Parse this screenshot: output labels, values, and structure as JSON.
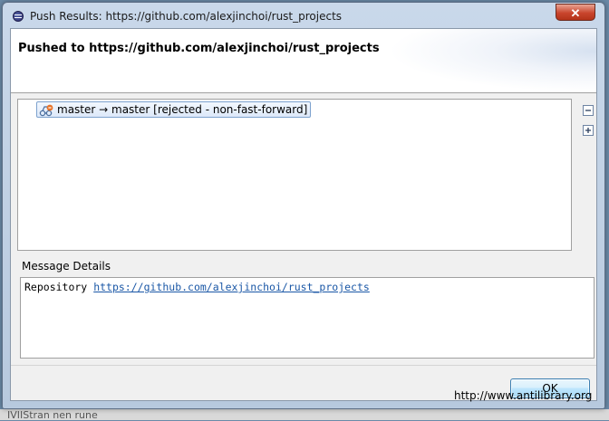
{
  "window": {
    "title": "Push Results: https://github.com/alexjinchoi/rust_projects",
    "close_glyph": "✕"
  },
  "header": {
    "text": "Pushed to https://github.com/alexjinchoi/rust_projects"
  },
  "tree": {
    "items": [
      {
        "label": "master → master [rejected - non-fast-forward]",
        "icon": "rejected-push-icon"
      }
    ]
  },
  "side_buttons": {
    "collapse": "collapse-all-icon",
    "expand": "expand-all-icon"
  },
  "message_details": {
    "label": "Message Details",
    "prefix": "Repository",
    "link": "https://github.com/alexjinchoi/rust_projects"
  },
  "buttons": {
    "ok": "OK"
  },
  "watermark": "http://www.antilibrary.org",
  "background": {
    "text": "IVIIStran nen rune"
  },
  "colors": {
    "link": "#1a57a6",
    "close_button": "#c9452d",
    "selection_border": "#7da2ce"
  }
}
